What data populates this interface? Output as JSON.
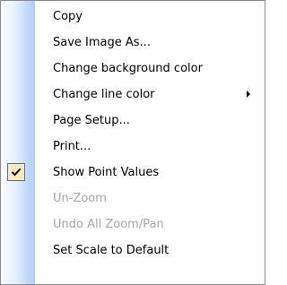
{
  "context_menu": {
    "items": [
      {
        "label": "Copy",
        "enabled": true,
        "checked": false,
        "submenu": false
      },
      {
        "label": "Save Image As...",
        "enabled": true,
        "checked": false,
        "submenu": false
      },
      {
        "label": "Change background color",
        "enabled": true,
        "checked": false,
        "submenu": false
      },
      {
        "label": "Change line color",
        "enabled": true,
        "checked": false,
        "submenu": true
      },
      {
        "label": "Page Setup...",
        "enabled": true,
        "checked": false,
        "submenu": false
      },
      {
        "label": "Print...",
        "enabled": true,
        "checked": false,
        "submenu": false
      },
      {
        "label": "Show Point Values",
        "enabled": true,
        "checked": true,
        "submenu": false
      },
      {
        "label": "Un-Zoom",
        "enabled": false,
        "checked": false,
        "submenu": false
      },
      {
        "label": "Undo All Zoom/Pan",
        "enabled": false,
        "checked": false,
        "submenu": false
      },
      {
        "label": "Set Scale to Default",
        "enabled": true,
        "checked": false,
        "submenu": false
      }
    ],
    "colors": {
      "text": "#000000",
      "disabled_text": "#a6a6a6",
      "check_highlight": "#fde9b7",
      "check_border": "#4b6fae",
      "gutter": "#c4daf8"
    },
    "icons": {
      "check": "checkmark-icon",
      "submenu": "submenu-arrow-icon"
    }
  }
}
